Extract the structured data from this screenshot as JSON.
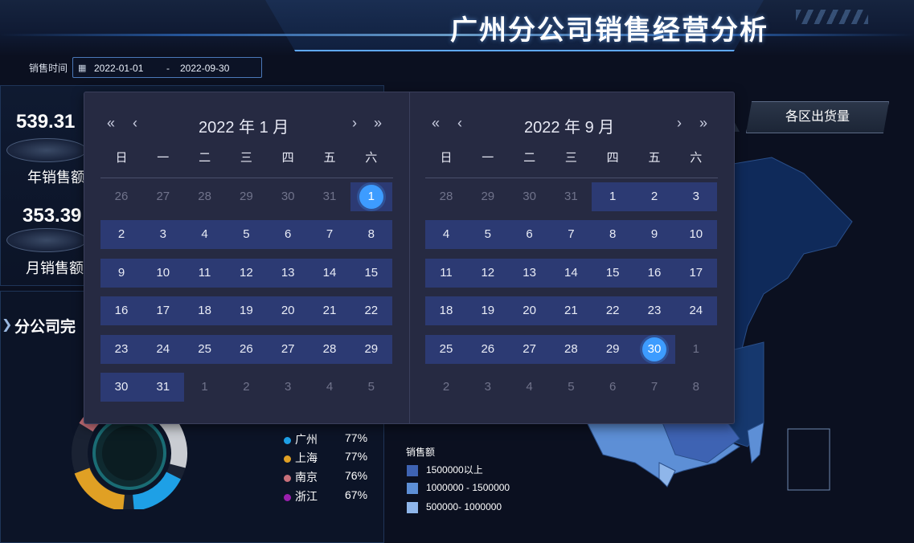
{
  "header": {
    "title": "广州分公司销售经营分析"
  },
  "filter": {
    "label": "销售时间",
    "start": "2022-01-01",
    "separator": "-",
    "end": "2022-09-30"
  },
  "kpis": [
    {
      "value": "539.31",
      "label": "年销售额"
    },
    {
      "value": "353.39",
      "label": "月销售额"
    }
  ],
  "section2": {
    "title": "分公司完"
  },
  "legend": [
    {
      "name": "广州",
      "pct": "77%",
      "color": "#1ea0e6"
    },
    {
      "name": "上海",
      "pct": "77%",
      "color": "#e0a024"
    },
    {
      "name": "南京",
      "pct": "76%",
      "color": "#c8707a"
    },
    {
      "name": "浙江",
      "pct": "67%",
      "color": "#9b1fae"
    }
  ],
  "map": {
    "tab_label": "各区出货量",
    "legend_title": "销售额",
    "legend_items": [
      {
        "label": "1500000以上",
        "color": "#3e63b3"
      },
      {
        "label": "1000000 - 1500000",
        "color": "#5d8fd6"
      },
      {
        "label": "500000- 1000000",
        "color": "#8fb6ea"
      }
    ]
  },
  "picker": {
    "nav": {
      "prev_year": "«",
      "prev_month": "‹",
      "next_month": "›",
      "next_year": "»"
    },
    "weekdays": [
      "日",
      "一",
      "二",
      "三",
      "四",
      "五",
      "六"
    ],
    "left": {
      "title": "2022 年 1 月",
      "rows": [
        [
          "26",
          "27",
          "28",
          "29",
          "30",
          "31",
          "1"
        ],
        [
          "2",
          "3",
          "4",
          "5",
          "6",
          "7",
          "8"
        ],
        [
          "9",
          "10",
          "11",
          "12",
          "13",
          "14",
          "15"
        ],
        [
          "16",
          "17",
          "18",
          "19",
          "20",
          "21",
          "22"
        ],
        [
          "23",
          "24",
          "25",
          "26",
          "27",
          "28",
          "29"
        ],
        [
          "30",
          "31",
          "1",
          "2",
          "3",
          "4",
          "5"
        ]
      ]
    },
    "right": {
      "title": "2022 年 9 月",
      "rows": [
        [
          "28",
          "29",
          "30",
          "31",
          "1",
          "2",
          "3"
        ],
        [
          "4",
          "5",
          "6",
          "7",
          "8",
          "9",
          "10"
        ],
        [
          "11",
          "12",
          "13",
          "14",
          "15",
          "16",
          "17"
        ],
        [
          "18",
          "19",
          "20",
          "21",
          "22",
          "23",
          "24"
        ],
        [
          "25",
          "26",
          "27",
          "28",
          "29",
          "30",
          "1"
        ],
        [
          "2",
          "3",
          "4",
          "5",
          "6",
          "7",
          "8"
        ]
      ]
    }
  }
}
